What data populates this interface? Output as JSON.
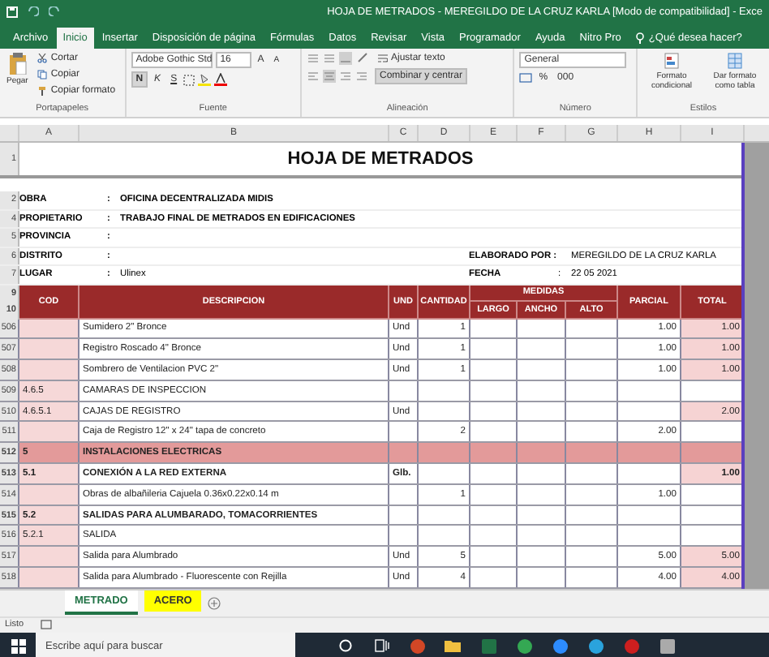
{
  "window": {
    "title": "HOJA DE METRADOS - MEREGILDO DE LA CRUZ KARLA  [Modo de compatibilidad]  -  Exce"
  },
  "menu": [
    {
      "label": "Archivo",
      "selected": false
    },
    {
      "label": "Inicio",
      "selected": true
    },
    {
      "label": "Insertar",
      "selected": false
    },
    {
      "label": "Disposición de página",
      "selected": false
    },
    {
      "label": "Fórmulas",
      "selected": false
    },
    {
      "label": "Datos",
      "selected": false
    },
    {
      "label": "Revisar",
      "selected": false
    },
    {
      "label": "Vista",
      "selected": false
    },
    {
      "label": "Programador",
      "selected": false
    },
    {
      "label": "Ayuda",
      "selected": false
    },
    {
      "label": "Nitro Pro",
      "selected": false
    }
  ],
  "tell_me": "¿Qué desea hacer?",
  "ribbon": {
    "clipboard": {
      "paste": "Pegar",
      "cut": "Cortar",
      "copy": "Copiar",
      "format_painter": "Copiar formato",
      "label": "Portapapeles"
    },
    "font": {
      "name": "Adobe Gothic Std",
      "size": "16",
      "bold": "N",
      "italic": "K",
      "underline": "S",
      "grow": "A",
      "shrink": "A",
      "label": "Fuente"
    },
    "alignment": {
      "wrap": "Ajustar texto",
      "merge": "Combinar y centrar",
      "label": "Alineación"
    },
    "number": {
      "format": "General",
      "percent": "%",
      "thousands": "000",
      "label": "Número"
    },
    "styles": {
      "conditional": "Formato condicional",
      "table": "Dar formato como tabla",
      "label": "Estilos"
    }
  },
  "columns": [
    "A",
    "B",
    "C",
    "D",
    "E",
    "F",
    "G",
    "H",
    "I"
  ],
  "sheet": {
    "title": "HOJA DE METRADOS",
    "title_row": "1",
    "info": [
      {
        "row": "2",
        "label": "OBRA",
        "sep": ":",
        "value": "OFICINA DECENTRALIZADA MIDIS"
      },
      {
        "row": "4",
        "label": "PROPIETARIO",
        "sep": ":",
        "value": "TRABAJO FINAL DE METRADOS EN EDIFICACIONES"
      },
      {
        "row": "5",
        "label": "PROVINCIA",
        "sep": ":"
      },
      {
        "row": "6",
        "label": "DISTRITO",
        "sep": ":",
        "right_label": "ELABORADO POR :",
        "right_value": "MEREGILDO DE LA CRUZ KARLA"
      },
      {
        "row": "7",
        "label": "LUGAR",
        "sep": ":",
        "value": "Ulinex",
        "right_label": "FECHA",
        "right_sep": ":",
        "right_value": "22 05 2021"
      }
    ],
    "header_rows": [
      "9",
      "10"
    ],
    "headers": {
      "cod": "COD",
      "desc": "DESCRIPCION",
      "und": "UND",
      "cantidad": "CANTIDAD",
      "medidas": "MEDIDAS",
      "largo": "LARGO",
      "ancho": "ANCHO",
      "alto": "ALTO",
      "parcial": "PARCIAL",
      "total": "TOTAL"
    },
    "rows": [
      {
        "num": "506",
        "kind": "item",
        "desc": "Sumidero  2\" Bronce",
        "und": "Und",
        "cantidad": "1",
        "parcial": "1.00",
        "total": "1.00"
      },
      {
        "num": "507",
        "kind": "item",
        "desc": "Registro Roscado 4\" Bronce",
        "und": "Und",
        "cantidad": "1",
        "parcial": "1.00",
        "total": "1.00"
      },
      {
        "num": "508",
        "kind": "item",
        "desc": "Sombrero de Ventilacion PVC 2\"",
        "und": "Und",
        "cantidad": "1",
        "parcial": "1.00",
        "total": "1.00"
      },
      {
        "num": "509",
        "kind": "item",
        "cod": "4.6.5",
        "desc": "CAMARAS DE INSPECCION"
      },
      {
        "num": "510",
        "kind": "item",
        "cod": "4.6.5.1",
        "desc": "CAJAS DE REGISTRO",
        "und": "Und",
        "total": "2.00"
      },
      {
        "num": "511",
        "kind": "item",
        "desc": "Caja de Registro 12\" x 24\" tapa de concreto",
        "cantidad": "2",
        "parcial": "2.00"
      },
      {
        "num": "512",
        "kind": "section",
        "cod": "5",
        "desc": "INSTALACIONES ELECTRICAS"
      },
      {
        "num": "513",
        "kind": "heading",
        "cod": "5.1",
        "desc": "CONEXIÓN A LA RED EXTERNA",
        "und": "Glb.",
        "total": "1.00"
      },
      {
        "num": "514",
        "kind": "item",
        "desc": "Obras de albañileria Cajuela 0.36x0.22x0.14 m",
        "cantidad": "1",
        "parcial": "1.00"
      },
      {
        "num": "515",
        "kind": "heading",
        "cod": "5.2",
        "desc": "SALIDAS PARA ALUMBARADO, TOMACORRIENTES"
      },
      {
        "num": "516",
        "kind": "item",
        "cod": "5.2.1",
        "desc": "SALIDA"
      },
      {
        "num": "517",
        "kind": "item",
        "desc": "Salida para Alumbrado",
        "und": "Und",
        "cantidad": "5",
        "parcial": "5.00",
        "total": "5.00"
      },
      {
        "num": "518",
        "kind": "item",
        "desc": "Salida para Alumbrado - Fluorescente con Rejilla",
        "und": "Und",
        "cantidad": "4",
        "parcial": "4.00",
        "total": "4.00"
      }
    ]
  },
  "sheet_tabs": [
    {
      "label": "METRADO",
      "selected": true,
      "color": "#ffffff"
    },
    {
      "label": "ACERO",
      "selected": false,
      "color": "#ffff00"
    }
  ],
  "status": "Listo",
  "taskbar": {
    "search_placeholder": "Escribe aquí para buscar"
  }
}
